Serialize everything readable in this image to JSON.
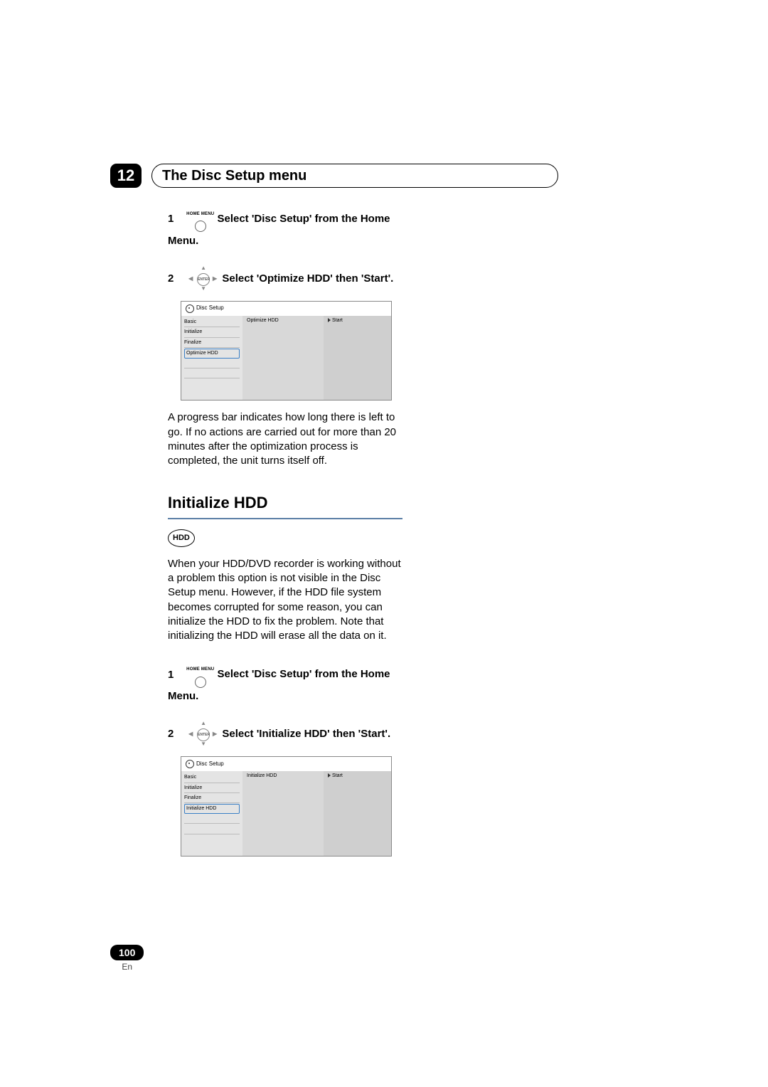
{
  "chapter": {
    "number": "12",
    "title": "The Disc Setup menu"
  },
  "section1": {
    "step1": {
      "num": "1",
      "btn_label": "HOME MENU",
      "text": "Select 'Disc Setup' from the Home Menu."
    },
    "step2": {
      "num": "2",
      "btn_label": "ENTER",
      "text": "Select 'Optimize HDD' then 'Start'."
    },
    "osd": {
      "title": "Disc Setup",
      "menu": [
        "Basic",
        "Initialize",
        "Finalize",
        "Optimize HDD"
      ],
      "col2": "Optimize HDD",
      "col3": "Start"
    },
    "body": "A progress bar indicates how long there is left to go. If no actions are carried out for more than 20 minutes after the optimization process is completed, the unit turns itself off."
  },
  "section2": {
    "heading": "Initialize HDD",
    "badge": "HDD",
    "body": "When your HDD/DVD recorder is working without a problem this option is not visible in the Disc Setup menu. However, if the HDD file system becomes corrupted for some reason, you can initialize the HDD to fix the problem. Note that initializing the HDD will erase all the data on it.",
    "step1": {
      "num": "1",
      "btn_label": "HOME MENU",
      "text": "Select 'Disc Setup' from the Home Menu."
    },
    "step2": {
      "num": "2",
      "btn_label": "ENTER",
      "text": "Select 'Initialize HDD' then 'Start'."
    },
    "osd": {
      "title": "Disc Setup",
      "menu": [
        "Basic",
        "Initialize",
        "Finalize",
        "Initialize HDD"
      ],
      "col2": "Initialize HDD",
      "col3": "Start"
    }
  },
  "footer": {
    "page": "100",
    "lang": "En"
  }
}
